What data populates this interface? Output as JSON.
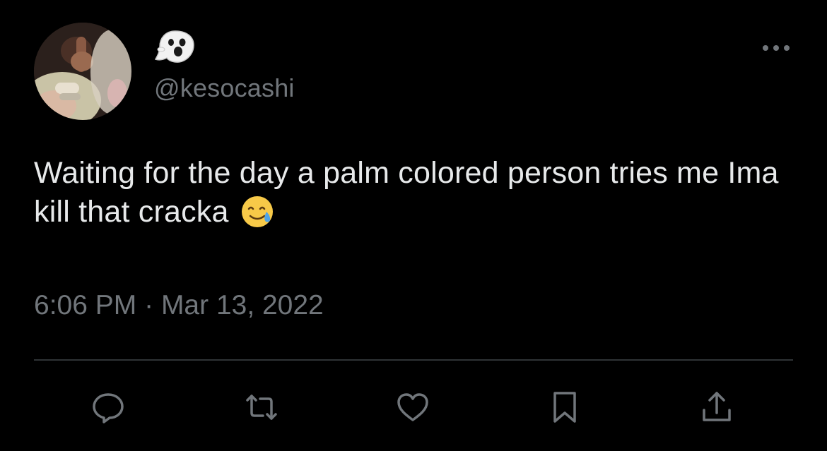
{
  "tweet": {
    "handle": "@kesocashi",
    "display_name_icon": "ghost-emoji",
    "text": "Waiting for the day a palm colored person tries me Ima kill that cracka",
    "text_emoji": "smiling-face-with-tear-emoji",
    "time": "6:06 PM",
    "separator": "·",
    "date": "Mar 13, 2022"
  },
  "actions": {
    "reply_icon": "reply-icon",
    "retweet_icon": "retweet-icon",
    "like_icon": "heart-icon",
    "bookmark_icon": "bookmark-icon",
    "share_icon": "share-icon"
  },
  "colors": {
    "background": "#000000",
    "text_primary": "#e7e9ea",
    "text_secondary": "#71767b",
    "divider": "#2f3336"
  }
}
